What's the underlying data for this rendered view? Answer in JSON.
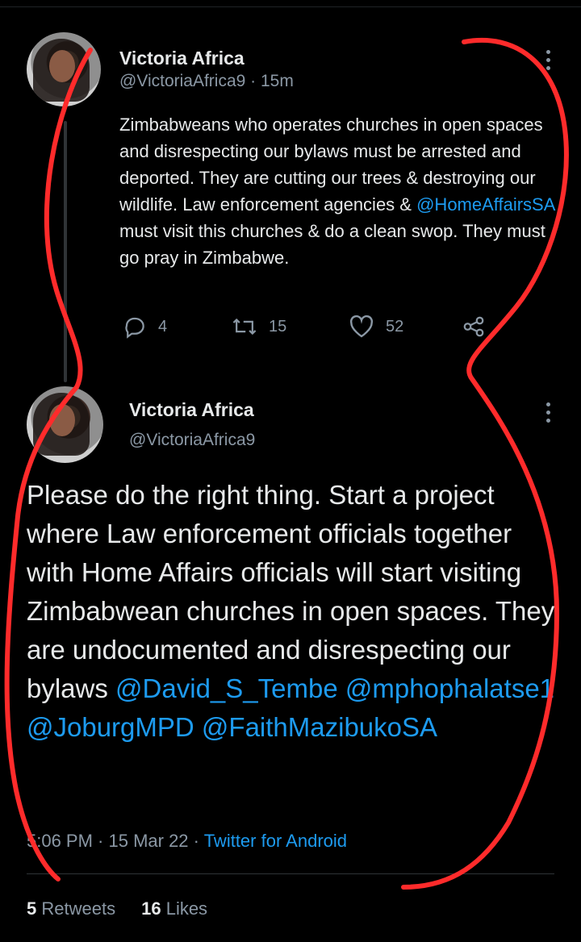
{
  "tweet1": {
    "name": "Victoria Africa",
    "handle": "@VictoriaAfrica9",
    "time": "· 15m",
    "text_a": "Zimbabweans who operates churches in open spaces and disrespecting our bylaws must be arrested and deported. They are cutting our trees & destroying our wildlife. Law enforcement agencies & ",
    "mention": "@HomeAffairsSA",
    "text_b": " must visit this churches & do a clean swop. They must go pray in Zimbabwe.",
    "replies": "4",
    "retweets": "15",
    "likes": "52"
  },
  "tweet2": {
    "name": "Victoria Africa",
    "handle": "@VictoriaAfrica9",
    "text": "Please do the right thing. Start a project where Law enforcement officials together with Home Affairs officials will start visiting Zimbabwean churches in open spaces. They are undocumented and disrespecting our bylaws ",
    "mentions": [
      "@David_S_Tembe",
      "@mphophalatse1",
      "@JoburgMPD",
      "@FaithMazibukoSA"
    ],
    "timestamp": "5:06 PM · 15 Mar 22 · ",
    "source": "Twitter for Android",
    "retweet_count": "5",
    "retweet_label": "Retweets",
    "like_count": "16",
    "like_label": "Likes"
  },
  "icons": [
    "more-icon",
    "reply-icon",
    "retweet-icon",
    "like-icon",
    "share-icon"
  ],
  "colors": {
    "background": "#000000",
    "text": "#e7e9ea",
    "secondary": "#8b98a5",
    "link": "#1d9bf0",
    "annotation": "#ff2b2b"
  }
}
